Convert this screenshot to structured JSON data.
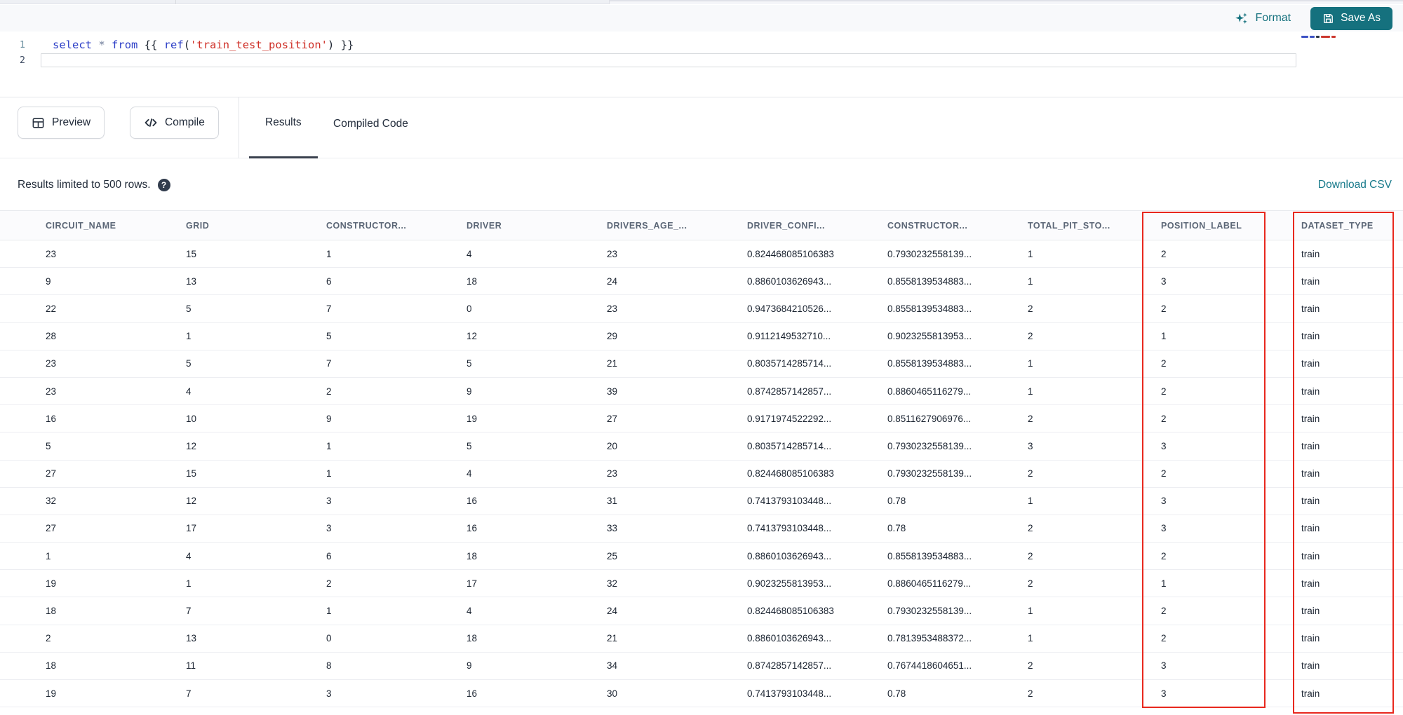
{
  "editor": {
    "format_label": "Format",
    "save_as_label": "Save As",
    "line_numbers": [
      "1",
      "2"
    ],
    "code_tokens": [
      {
        "t": "select",
        "c": "kw"
      },
      {
        "t": " ",
        "c": "pl"
      },
      {
        "t": "*",
        "c": "op"
      },
      {
        "t": " ",
        "c": "pl"
      },
      {
        "t": "from",
        "c": "kw"
      },
      {
        "t": " ",
        "c": "pl"
      },
      {
        "t": "{{ ",
        "c": "br"
      },
      {
        "t": "ref",
        "c": "fn"
      },
      {
        "t": "(",
        "c": "br"
      },
      {
        "t": "'train_test_position'",
        "c": "str"
      },
      {
        "t": ")",
        "c": "br"
      },
      {
        "t": " }}",
        "c": "br"
      }
    ]
  },
  "toolbar": {
    "preview_label": "Preview",
    "compile_label": "Compile",
    "tabs": [
      {
        "label": "Results",
        "active": true
      },
      {
        "label": "Compiled Code",
        "active": false
      }
    ]
  },
  "results": {
    "limit_note": "Results limited to 500 rows.",
    "help_icon_glyph": "?",
    "download_label": "Download CSV"
  },
  "table": {
    "columns": [
      "CIRCUIT_NAME",
      "GRID",
      "CONSTRUCTOR...",
      "DRIVER",
      "DRIVERS_AGE_...",
      "DRIVER_CONFI...",
      "CONSTRUCTOR...",
      "TOTAL_PIT_STO...",
      "POSITION_LABEL",
      "DATASET_TYPE"
    ],
    "highlighted_columns": [
      "POSITION_LABEL",
      "DATASET_TYPE"
    ],
    "rows": [
      [
        "23",
        "15",
        "1",
        "4",
        "23",
        "0.824468085106383",
        "0.7930232558139...",
        "1",
        "2",
        "train"
      ],
      [
        "9",
        "13",
        "6",
        "18",
        "24",
        "0.8860103626943...",
        "0.8558139534883...",
        "1",
        "3",
        "train"
      ],
      [
        "22",
        "5",
        "7",
        "0",
        "23",
        "0.9473684210526...",
        "0.8558139534883...",
        "2",
        "2",
        "train"
      ],
      [
        "28",
        "1",
        "5",
        "12",
        "29",
        "0.9112149532710...",
        "0.9023255813953...",
        "2",
        "1",
        "train"
      ],
      [
        "23",
        "5",
        "7",
        "5",
        "21",
        "0.8035714285714...",
        "0.8558139534883...",
        "1",
        "2",
        "train"
      ],
      [
        "23",
        "4",
        "2",
        "9",
        "39",
        "0.8742857142857...",
        "0.8860465116279...",
        "1",
        "2",
        "train"
      ],
      [
        "16",
        "10",
        "9",
        "19",
        "27",
        "0.9171974522292...",
        "0.8511627906976...",
        "2",
        "2",
        "train"
      ],
      [
        "5",
        "12",
        "1",
        "5",
        "20",
        "0.8035714285714...",
        "0.7930232558139...",
        "3",
        "3",
        "train"
      ],
      [
        "27",
        "15",
        "1",
        "4",
        "23",
        "0.824468085106383",
        "0.7930232558139...",
        "2",
        "2",
        "train"
      ],
      [
        "32",
        "12",
        "3",
        "16",
        "31",
        "0.7413793103448...",
        "0.78",
        "1",
        "3",
        "train"
      ],
      [
        "27",
        "17",
        "3",
        "16",
        "33",
        "0.7413793103448...",
        "0.78",
        "2",
        "3",
        "train"
      ],
      [
        "1",
        "4",
        "6",
        "18",
        "25",
        "0.8860103626943...",
        "0.8558139534883...",
        "2",
        "2",
        "train"
      ],
      [
        "19",
        "1",
        "2",
        "17",
        "32",
        "0.9023255813953...",
        "0.8860465116279...",
        "2",
        "1",
        "train"
      ],
      [
        "18",
        "7",
        "1",
        "4",
        "24",
        "0.824468085106383",
        "0.7930232558139...",
        "1",
        "2",
        "train"
      ],
      [
        "2",
        "13",
        "0",
        "18",
        "21",
        "0.8860103626943...",
        "0.7813953488372...",
        "1",
        "2",
        "train"
      ],
      [
        "18",
        "11",
        "8",
        "9",
        "34",
        "0.8742857142857...",
        "0.7674418604651...",
        "2",
        "3",
        "train"
      ],
      [
        "19",
        "7",
        "3",
        "16",
        "30",
        "0.7413793103448...",
        "0.78",
        "2",
        "3",
        "train"
      ]
    ]
  },
  "colors": {
    "accent_teal": "#15717e",
    "highlight_red": "#e8281e",
    "keyword_blue": "#2d3fc7",
    "string_red": "#cf3028"
  }
}
